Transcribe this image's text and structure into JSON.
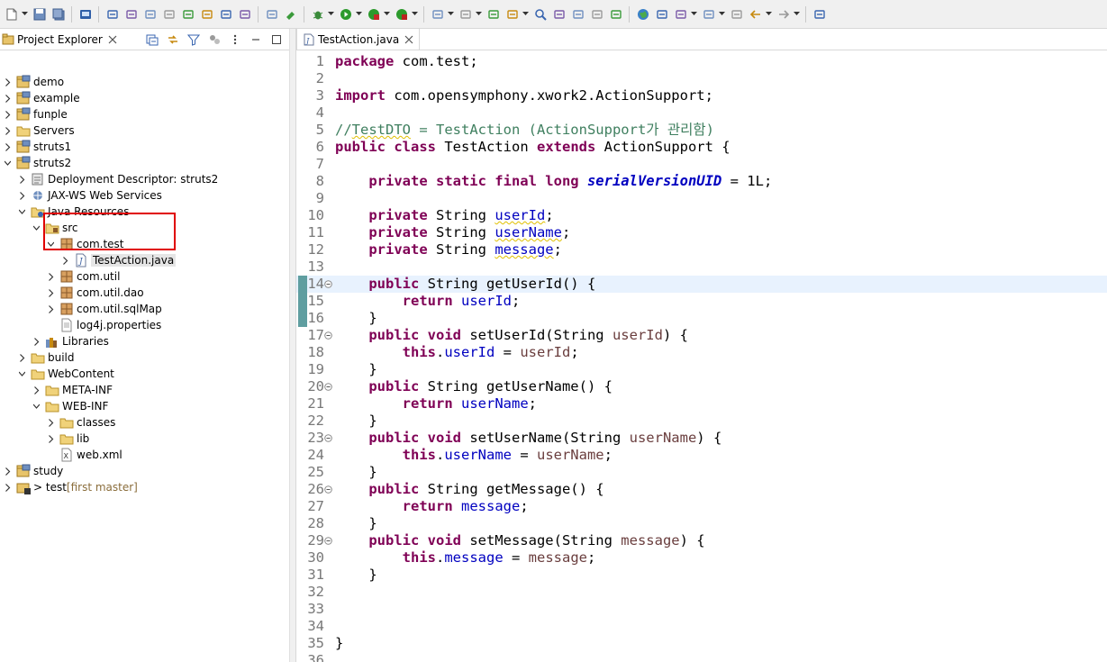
{
  "toolbar": {
    "icons": [
      "new-icon",
      "save-icon",
      "save-all-icon",
      "terminal-icon",
      "debug-skip-icon",
      "resume-icon",
      "suspend-icon",
      "terminate-icon",
      "disconnect-icon",
      "step-into-icon",
      "step-over-icon",
      "step-return-icon",
      "word-wrap-icon",
      "build-icon",
      "debug-icon",
      "run-icon",
      "coverage-icon",
      "external-tools-icon",
      "new-server-icon",
      "new-java-package-icon",
      "open-type-icon",
      "open-task-icon",
      "search-icon",
      "annotation-icon",
      "mark-occurrences-icon",
      "toggle-breadcrumb-icon",
      "show-whitespace-icon",
      "globe-icon",
      "link-icon",
      "next-annotation-icon",
      "previous-annotation-icon",
      "last-edit-icon",
      "back-icon",
      "forward-icon",
      "pin-editor-icon"
    ]
  },
  "explorer": {
    "title": "Project Explorer",
    "tree": [
      {
        "label": "demo",
        "depth": 0,
        "expanded": false,
        "icon": "project-icon"
      },
      {
        "label": "example",
        "depth": 0,
        "expanded": false,
        "icon": "project-icon"
      },
      {
        "label": "funple",
        "depth": 0,
        "expanded": false,
        "icon": "project-icon"
      },
      {
        "label": "Servers",
        "depth": 0,
        "expanded": false,
        "icon": "folder-icon"
      },
      {
        "label": "struts1",
        "depth": 0,
        "expanded": false,
        "icon": "project-icon"
      },
      {
        "label": "struts2",
        "depth": 0,
        "expanded": true,
        "icon": "project-icon"
      },
      {
        "label": "Deployment Descriptor: struts2",
        "depth": 1,
        "expanded": false,
        "icon": "descriptor-icon"
      },
      {
        "label": "JAX-WS Web Services",
        "depth": 1,
        "expanded": false,
        "icon": "webservice-icon"
      },
      {
        "label": "Java Resources",
        "depth": 1,
        "expanded": true,
        "icon": "java-resources-icon"
      },
      {
        "label": "src",
        "depth": 2,
        "expanded": true,
        "icon": "source-folder-icon"
      },
      {
        "label": "com.test",
        "depth": 3,
        "expanded": true,
        "icon": "package-icon"
      },
      {
        "label": "TestAction.java",
        "depth": 4,
        "expanded": false,
        "icon": "java-file-icon",
        "selected": true
      },
      {
        "label": "com.util",
        "depth": 3,
        "expanded": false,
        "icon": "package-icon"
      },
      {
        "label": "com.util.dao",
        "depth": 3,
        "expanded": false,
        "icon": "package-icon"
      },
      {
        "label": "com.util.sqlMap",
        "depth": 3,
        "expanded": false,
        "icon": "package-icon"
      },
      {
        "label": "log4j.properties",
        "depth": 3,
        "leaf": true,
        "icon": "properties-file-icon"
      },
      {
        "label": "Libraries",
        "depth": 2,
        "expanded": false,
        "icon": "library-icon"
      },
      {
        "label": "build",
        "depth": 1,
        "expanded": false,
        "icon": "folder-icon"
      },
      {
        "label": "WebContent",
        "depth": 1,
        "expanded": true,
        "icon": "folder-icon"
      },
      {
        "label": "META-INF",
        "depth": 2,
        "expanded": false,
        "icon": "folder-icon"
      },
      {
        "label": "WEB-INF",
        "depth": 2,
        "expanded": true,
        "icon": "folder-icon"
      },
      {
        "label": "classes",
        "depth": 3,
        "expanded": false,
        "icon": "folder-icon"
      },
      {
        "label": "lib",
        "depth": 3,
        "expanded": false,
        "icon": "folder-icon"
      },
      {
        "label": "web.xml",
        "depth": 3,
        "leaf": true,
        "icon": "xml-file-icon"
      },
      {
        "label": "study",
        "depth": 0,
        "expanded": false,
        "icon": "project-icon"
      },
      {
        "label": "> test",
        "decoration": "[first master]",
        "depth": 0,
        "expanded": false,
        "icon": "git-project-icon"
      }
    ]
  },
  "editor": {
    "tab_title": "TestAction.java",
    "current_line": 14,
    "lines": [
      {
        "n": "1",
        "t": [
          [
            "kw",
            "package"
          ],
          [
            "",
            "com.test;"
          ]
        ]
      },
      {
        "n": "2",
        "t": []
      },
      {
        "n": "3",
        "t": [
          [
            "kw",
            "import"
          ],
          [
            "",
            "com.opensymphony.xwork2.ActionSupport;"
          ]
        ]
      },
      {
        "n": "4",
        "t": []
      },
      {
        "n": "5",
        "t": [
          [
            "cm",
            "//"
          ],
          [
            "cm wv",
            "TestDTO"
          ],
          [
            "cm",
            " = TestAction (ActionSupport가 관리함)"
          ]
        ]
      },
      {
        "n": "6",
        "t": [
          [
            "kw",
            "public"
          ],
          [
            "",
            " "
          ],
          [
            "kw",
            "class"
          ],
          [
            "",
            " TestAction "
          ],
          [
            "kw",
            "extends"
          ],
          [
            "",
            " ActionSupport {"
          ]
        ]
      },
      {
        "n": "7",
        "t": []
      },
      {
        "n": "8",
        "t": [
          [
            "",
            "    "
          ],
          [
            "kw",
            "private static final long"
          ],
          [
            "",
            " "
          ],
          [
            "sfld",
            "serialVersionUID"
          ],
          [
            "",
            " = 1L;"
          ]
        ]
      },
      {
        "n": "9",
        "t": []
      },
      {
        "n": "10",
        "t": [
          [
            "",
            "    "
          ],
          [
            "kw",
            "private"
          ],
          [
            "",
            " String "
          ],
          [
            "fld wv",
            "userId"
          ],
          [
            "",
            ";"
          ]
        ]
      },
      {
        "n": "11",
        "t": [
          [
            "",
            "    "
          ],
          [
            "kw",
            "private"
          ],
          [
            "",
            " String "
          ],
          [
            "fld wv",
            "userName"
          ],
          [
            "",
            ";"
          ]
        ]
      },
      {
        "n": "12",
        "t": [
          [
            "",
            "    "
          ],
          [
            "kw",
            "private"
          ],
          [
            "",
            " String "
          ],
          [
            "fld wv",
            "message"
          ],
          [
            "",
            ";"
          ]
        ]
      },
      {
        "n": "13",
        "t": []
      },
      {
        "n": "14",
        "fold": true,
        "t": [
          [
            "",
            "    "
          ],
          [
            "kw",
            "public"
          ],
          [
            "",
            " String getUserId() {"
          ]
        ]
      },
      {
        "n": "15",
        "t": [
          [
            "",
            "        "
          ],
          [
            "kw",
            "return"
          ],
          [
            "",
            " "
          ],
          [
            "fld",
            "userId"
          ],
          [
            "",
            ";"
          ]
        ]
      },
      {
        "n": "16",
        "t": [
          [
            "",
            "    }"
          ]
        ]
      },
      {
        "n": "17",
        "fold": true,
        "t": [
          [
            "",
            "    "
          ],
          [
            "kw",
            "public void"
          ],
          [
            "",
            " setUserId(String "
          ],
          [
            "prm",
            "userId"
          ],
          [
            "",
            ") {"
          ]
        ]
      },
      {
        "n": "18",
        "t": [
          [
            "",
            "        "
          ],
          [
            "kw",
            "this"
          ],
          [
            "",
            "."
          ],
          [
            "fld",
            "userId"
          ],
          [
            "",
            " = "
          ],
          [
            "prm",
            "userId"
          ],
          [
            "",
            ";"
          ]
        ]
      },
      {
        "n": "19",
        "t": [
          [
            "",
            "    }"
          ]
        ]
      },
      {
        "n": "20",
        "fold": true,
        "t": [
          [
            "",
            "    "
          ],
          [
            "kw",
            "public"
          ],
          [
            "",
            " String getUserName() {"
          ]
        ]
      },
      {
        "n": "21",
        "t": [
          [
            "",
            "        "
          ],
          [
            "kw",
            "return"
          ],
          [
            "",
            " "
          ],
          [
            "fld",
            "userName"
          ],
          [
            "",
            ";"
          ]
        ]
      },
      {
        "n": "22",
        "t": [
          [
            "",
            "    }"
          ]
        ]
      },
      {
        "n": "23",
        "fold": true,
        "t": [
          [
            "",
            "    "
          ],
          [
            "kw",
            "public void"
          ],
          [
            "",
            " setUserName(String "
          ],
          [
            "prm",
            "userName"
          ],
          [
            "",
            ") {"
          ]
        ]
      },
      {
        "n": "24",
        "t": [
          [
            "",
            "        "
          ],
          [
            "kw",
            "this"
          ],
          [
            "",
            "."
          ],
          [
            "fld",
            "userName"
          ],
          [
            "",
            " = "
          ],
          [
            "prm",
            "userName"
          ],
          [
            "",
            ";"
          ]
        ]
      },
      {
        "n": "25",
        "t": [
          [
            "",
            "    }"
          ]
        ]
      },
      {
        "n": "26",
        "fold": true,
        "t": [
          [
            "",
            "    "
          ],
          [
            "kw",
            "public"
          ],
          [
            "",
            " String getMessage() {"
          ]
        ]
      },
      {
        "n": "27",
        "t": [
          [
            "",
            "        "
          ],
          [
            "kw",
            "return"
          ],
          [
            "",
            " "
          ],
          [
            "fld",
            "message"
          ],
          [
            "",
            ";"
          ]
        ]
      },
      {
        "n": "28",
        "t": [
          [
            "",
            "    }"
          ]
        ]
      },
      {
        "n": "29",
        "fold": true,
        "t": [
          [
            "",
            "    "
          ],
          [
            "kw",
            "public void"
          ],
          [
            "",
            " setMessage(String "
          ],
          [
            "prm",
            "message"
          ],
          [
            "",
            ") {"
          ]
        ]
      },
      {
        "n": "30",
        "t": [
          [
            "",
            "        "
          ],
          [
            "kw",
            "this"
          ],
          [
            "",
            "."
          ],
          [
            "fld",
            "message"
          ],
          [
            "",
            " = "
          ],
          [
            "prm",
            "message"
          ],
          [
            "",
            ";"
          ]
        ]
      },
      {
        "n": "31",
        "t": [
          [
            "",
            "    }"
          ]
        ]
      },
      {
        "n": "32",
        "t": []
      },
      {
        "n": "33",
        "t": []
      },
      {
        "n": "34",
        "t": []
      },
      {
        "n": "35",
        "t": [
          [
            "",
            "}"
          ]
        ]
      },
      {
        "n": "36",
        "t": []
      }
    ]
  },
  "colors": {
    "keyword": "#7f0055",
    "comment": "#3f7f5f",
    "field": "#0000c0",
    "parameter": "#6a3e3e",
    "highlight_box": "#e00000",
    "current_line": "#e8f2fe"
  }
}
